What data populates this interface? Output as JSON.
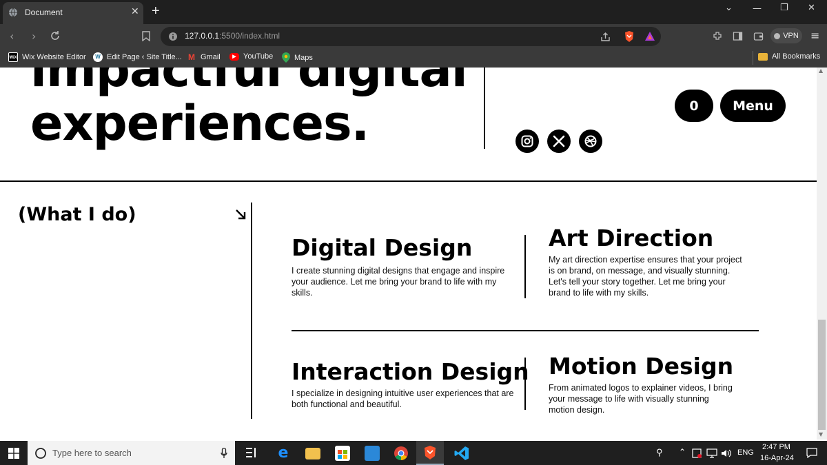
{
  "browser": {
    "tab_title": "Document",
    "close_tab": "✕",
    "new_tab": "+",
    "url_host": "127.0.0.1",
    "url_path": ":5500/index.html",
    "vpn_label": "VPN",
    "bookmarks": [
      {
        "label": "Wix Website Editor",
        "icon": "wix-icon",
        "color": "#000000"
      },
      {
        "label": "Edit Page ‹ Site Title...",
        "icon": "wordpress-icon",
        "color": "#21759b"
      },
      {
        "label": "Gmail",
        "icon": "gmail-icon",
        "color": "#d93025"
      },
      {
        "label": "YouTube",
        "icon": "youtube-icon",
        "color": "#ff0000"
      },
      {
        "label": "Maps",
        "icon": "maps-icon",
        "color": "#34a853"
      }
    ],
    "all_bookmarks": "All Bookmarks"
  },
  "page": {
    "hero_line1": "impactful digital",
    "hero_line2": "experiences.",
    "cart_count": "0",
    "menu_label": "Menu",
    "social_icons": [
      "instagram-icon",
      "x-icon",
      "dribbble-icon"
    ],
    "section_title": "(What I do)",
    "services": [
      {
        "title": "Digital Design",
        "desc": "I create stunning digital designs that engage and inspire your audience. Let me bring your brand to life with my skills."
      },
      {
        "title": "Art Direction",
        "desc": "My art direction expertise ensures that your project is on brand, on message, and visually stunning. Let's tell your story together. Let me bring your brand to life with my skills."
      },
      {
        "title": "Interaction Design",
        "desc": "I specialize in designing intuitive user experiences that are both functional and beautiful."
      },
      {
        "title": "Motion Design",
        "desc": "From animated logos to explainer videos, I bring your message to life with visually stunning motion design."
      }
    ]
  },
  "taskbar": {
    "search_placeholder": "Type here to search",
    "language": "ENG",
    "time": "2:47 PM",
    "date": "16-Apr-24"
  }
}
